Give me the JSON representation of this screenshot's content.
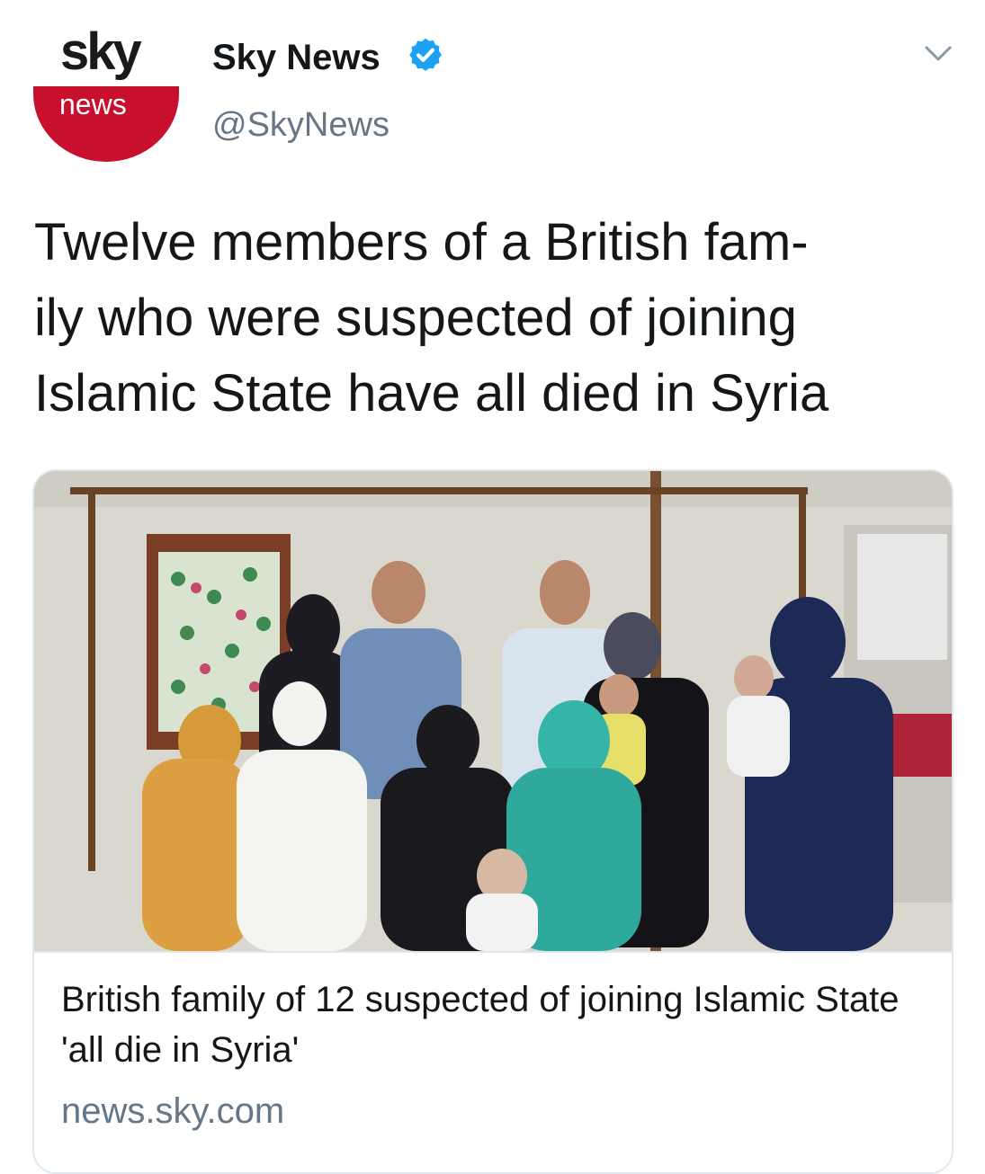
{
  "author": {
    "logo_top": "sky",
    "logo_bottom": "news",
    "name": "Sky News",
    "handle": "@SkyNews",
    "verified": true
  },
  "tweet": {
    "text_lines": [
      "Twelve members of a British fam-",
      "ily who were suspected of joining",
      "Islamic State have all died in Syria"
    ]
  },
  "card": {
    "image_alt": "Photo of a family group posing in a room",
    "title": "British family of 12 suspected of joining Islamic State 'all die in Syria'",
    "domain": "news.sky.com"
  },
  "colors": {
    "sky_red": "#c8102e",
    "verified_blue": "#1da1f2",
    "muted_text": "#657786",
    "border": "#e1e8ed"
  },
  "icons": {
    "verified": "verified-badge-icon",
    "menu": "chevron-down-icon"
  }
}
